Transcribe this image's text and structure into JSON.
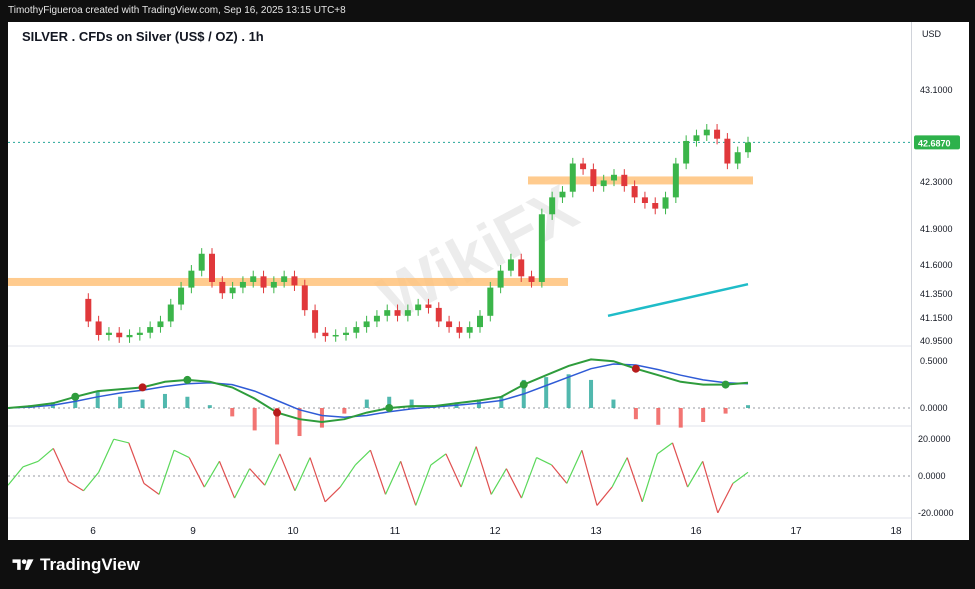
{
  "header": {
    "credit": "TimothyFigueroa created with TradingView.com, Sep 16, 2025 13:15 UTC+8"
  },
  "chart_title": "SILVER . CFDs on Silver (US$ / OZ) . 1h",
  "currency": "USD",
  "footer": {
    "brand": "TradingView"
  },
  "watermark": "WikiFX",
  "colors": {
    "up": "#26a69a",
    "down": "#ef5350",
    "candle_up": "#3bb54a",
    "candle_down": "#e0383b",
    "zone": "#ffc27a",
    "ma": "#1fbcc8",
    "macd": "#2e9c3c",
    "signal": "#2f5bd6",
    "last_price_bg": "#2db14b"
  },
  "chart_data": {
    "type": "line",
    "title": "SILVER . CFDs on Silver (US$ / OZ) . 1h",
    "x_ticks": [
      "6",
      "9",
      "10",
      "11",
      "12",
      "13",
      "16",
      "17",
      "18"
    ],
    "price_axis": {
      "ticks": [
        "43.1000",
        "42.3000",
        "41.9000",
        "41.6000",
        "41.3500",
        "41.1500",
        "40.9500"
      ],
      "last_price": "42.6870",
      "range": [
        40.9,
        43.4
      ]
    },
    "price_series": [
      41.3,
      41.1,
      40.98,
      41.0,
      40.96,
      40.98,
      41.0,
      41.05,
      41.1,
      41.25,
      41.4,
      41.55,
      41.7,
      41.45,
      41.35,
      41.4,
      41.45,
      41.5,
      41.4,
      41.45,
      41.5,
      41.42,
      41.2,
      41.0,
      40.97,
      40.98,
      41.0,
      41.05,
      41.1,
      41.15,
      41.2,
      41.15,
      41.2,
      41.25,
      41.22,
      41.1,
      41.05,
      41.0,
      41.05,
      41.15,
      41.4,
      41.55,
      41.65,
      41.5,
      41.45,
      42.05,
      42.2,
      42.25,
      42.5,
      42.45,
      42.3,
      42.35,
      42.4,
      42.3,
      42.2,
      42.15,
      42.1,
      42.2,
      42.5,
      42.7,
      42.75,
      42.8,
      42.72,
      42.5,
      42.6,
      42.687
    ],
    "resistance_zones": [
      41.45,
      42.35
    ],
    "moving_average": [
      [
        41.15,
        41.15
      ],
      [
        41.47,
        41.43
      ]
    ],
    "macd": {
      "ticks": [
        "0.5000",
        "0.0000"
      ],
      "range": [
        -0.15,
        0.62
      ],
      "macd": [
        0.0,
        0.02,
        0.05,
        0.12,
        0.18,
        0.2,
        0.22,
        0.28,
        0.3,
        0.28,
        0.22,
        0.1,
        -0.05,
        -0.12,
        -0.15,
        -0.12,
        -0.05,
        0.0,
        0.02,
        0.02,
        0.05,
        0.08,
        0.12,
        0.25,
        0.35,
        0.45,
        0.52,
        0.5,
        0.42,
        0.35,
        0.28,
        0.25,
        0.25,
        0.27
      ],
      "signal": [
        0.0,
        0.01,
        0.03,
        0.07,
        0.12,
        0.16,
        0.19,
        0.23,
        0.26,
        0.27,
        0.25,
        0.18,
        0.08,
        -0.02,
        -0.08,
        -0.1,
        -0.08,
        -0.04,
        -0.01,
        0.01,
        0.03,
        0.05,
        0.08,
        0.15,
        0.24,
        0.33,
        0.42,
        0.47,
        0.46,
        0.41,
        0.35,
        0.3,
        0.27,
        0.26
      ]
    },
    "oscillator": {
      "ticks": [
        "20.0000",
        "0.0000",
        "-20.0000"
      ],
      "range": [
        -25,
        25
      ],
      "values": [
        -5,
        5,
        8,
        15,
        -3,
        -8,
        2,
        20,
        18,
        -4,
        -10,
        14,
        10,
        -6,
        8,
        -12,
        4,
        -5,
        12,
        -8,
        10,
        -14,
        -6,
        6,
        14,
        -10,
        8,
        -16,
        6,
        12,
        -6,
        16,
        -10,
        4,
        -12,
        10,
        6,
        -4,
        14,
        -16,
        -6,
        10,
        -14,
        12,
        18,
        -6,
        8,
        -20,
        -4,
        2
      ]
    }
  }
}
